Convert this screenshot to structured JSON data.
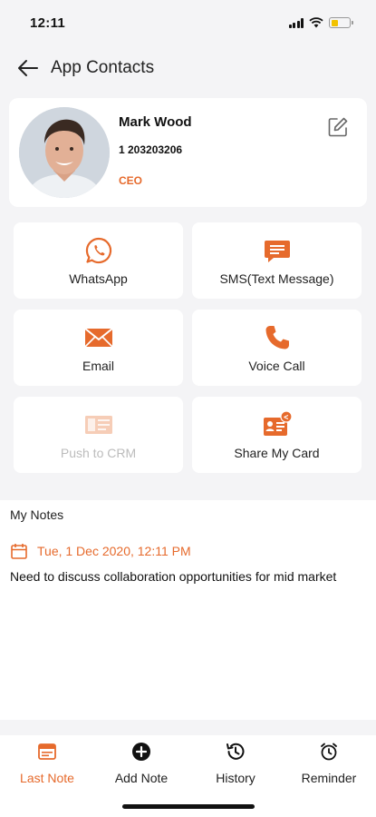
{
  "status_bar": {
    "time": "12:11"
  },
  "header": {
    "title": "App Contacts"
  },
  "contact": {
    "name": "Mark Wood",
    "phone": "1 203203206",
    "title": "CEO"
  },
  "actions": [
    {
      "label": "WhatsApp",
      "icon": "whatsapp-icon",
      "enabled": true
    },
    {
      "label": "SMS(Text Message)",
      "icon": "sms-icon",
      "enabled": true
    },
    {
      "label": "Email",
      "icon": "email-icon",
      "enabled": true
    },
    {
      "label": "Voice Call",
      "icon": "phone-icon",
      "enabled": true
    },
    {
      "label": "Push to CRM",
      "icon": "crm-icon",
      "enabled": false
    },
    {
      "label": "Share My Card",
      "icon": "share-card-icon",
      "enabled": true
    }
  ],
  "notes": {
    "heading": "My Notes",
    "date": "Tue, 1 Dec 2020, 12:11 PM",
    "text": "Need to discuss collaboration opportunities for mid market"
  },
  "tabs": [
    {
      "label": "Last Note",
      "icon": "last-note-icon",
      "active": true
    },
    {
      "label": "Add Note",
      "icon": "add-note-icon",
      "active": false
    },
    {
      "label": "History",
      "icon": "history-icon",
      "active": false
    },
    {
      "label": "Reminder",
      "icon": "alarm-icon",
      "active": false
    }
  ],
  "colors": {
    "accent": "#e66a2c",
    "disabled": "#bcbcbc",
    "background": "#f4f4f6",
    "card": "#ffffff"
  }
}
